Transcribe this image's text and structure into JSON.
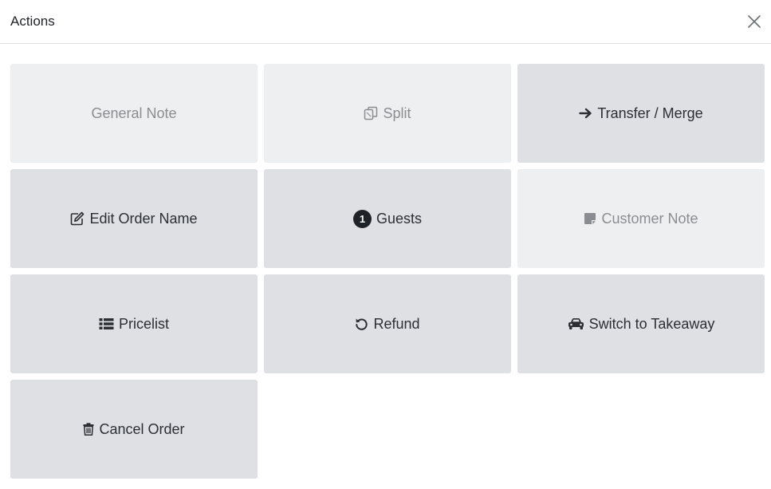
{
  "dialog": {
    "title": "Actions",
    "close_icon": "close-icon"
  },
  "actions": {
    "general_note": {
      "label": "General Note",
      "state": "disabled"
    },
    "split": {
      "label": "Split",
      "icon": "copy-icon",
      "state": "disabled"
    },
    "transfer_merge": {
      "label": "Transfer / Merge",
      "icon": "arrow-right-icon",
      "state": "enabled"
    },
    "edit_order_name": {
      "label": "Edit Order Name",
      "icon": "edit-icon",
      "state": "enabled"
    },
    "guests": {
      "label": "Guests",
      "count": "1",
      "state": "enabled"
    },
    "customer_note": {
      "label": "Customer Note",
      "icon": "sticky-note-icon",
      "state": "disabled"
    },
    "pricelist": {
      "label": "Pricelist",
      "icon": "list-icon",
      "state": "enabled"
    },
    "refund": {
      "label": "Refund",
      "icon": "undo-icon",
      "state": "enabled"
    },
    "switch_to_takeaway": {
      "label": "Switch to Takeaway",
      "icon": "car-icon",
      "state": "enabled"
    },
    "cancel_order": {
      "label": "Cancel Order",
      "icon": "trash-icon",
      "state": "enabled"
    }
  },
  "colors": {
    "enabled_bg": "#dee0e4",
    "disabled_bg": "#eeeff1",
    "enabled_text": "#2b2f33",
    "disabled_text": "#8a8d91"
  }
}
